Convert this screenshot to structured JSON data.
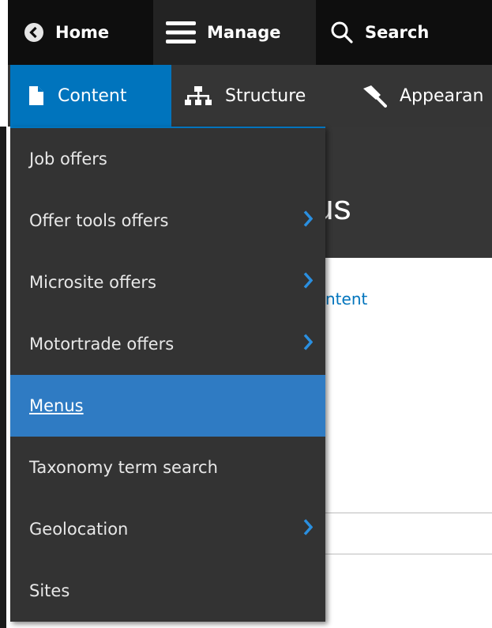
{
  "toolbar": {
    "home_label": "Home",
    "manage_label": "Manage",
    "search_label": "Search"
  },
  "tabs": [
    {
      "label": "Content",
      "icon": "file-icon",
      "active": true
    },
    {
      "label": "Structure",
      "icon": "hierarchy-icon"
    },
    {
      "label": "Appearan",
      "icon": "paintbrush-icon"
    }
  ],
  "page": {
    "title_fragment": "us",
    "link_fragment": "ntent"
  },
  "menu": {
    "items": [
      {
        "label": "Job offers",
        "has_submenu": false
      },
      {
        "label": "Offer tools offers",
        "has_submenu": true
      },
      {
        "label": "Microsite offers",
        "has_submenu": true
      },
      {
        "label": "Motortrade offers",
        "has_submenu": true
      },
      {
        "label": "Menus",
        "has_submenu": false,
        "active": true
      },
      {
        "label": "Taxonomy term search",
        "has_submenu": false
      },
      {
        "label": "Geolocation",
        "has_submenu": true
      },
      {
        "label": "Sites",
        "has_submenu": false
      }
    ]
  },
  "colors": {
    "accent": "#0074bd",
    "active_item": "#2f7bc3",
    "chevron": "#2a8fe0",
    "menu_bg": "#333333",
    "toolbar_bg": "#0e0e0e"
  }
}
